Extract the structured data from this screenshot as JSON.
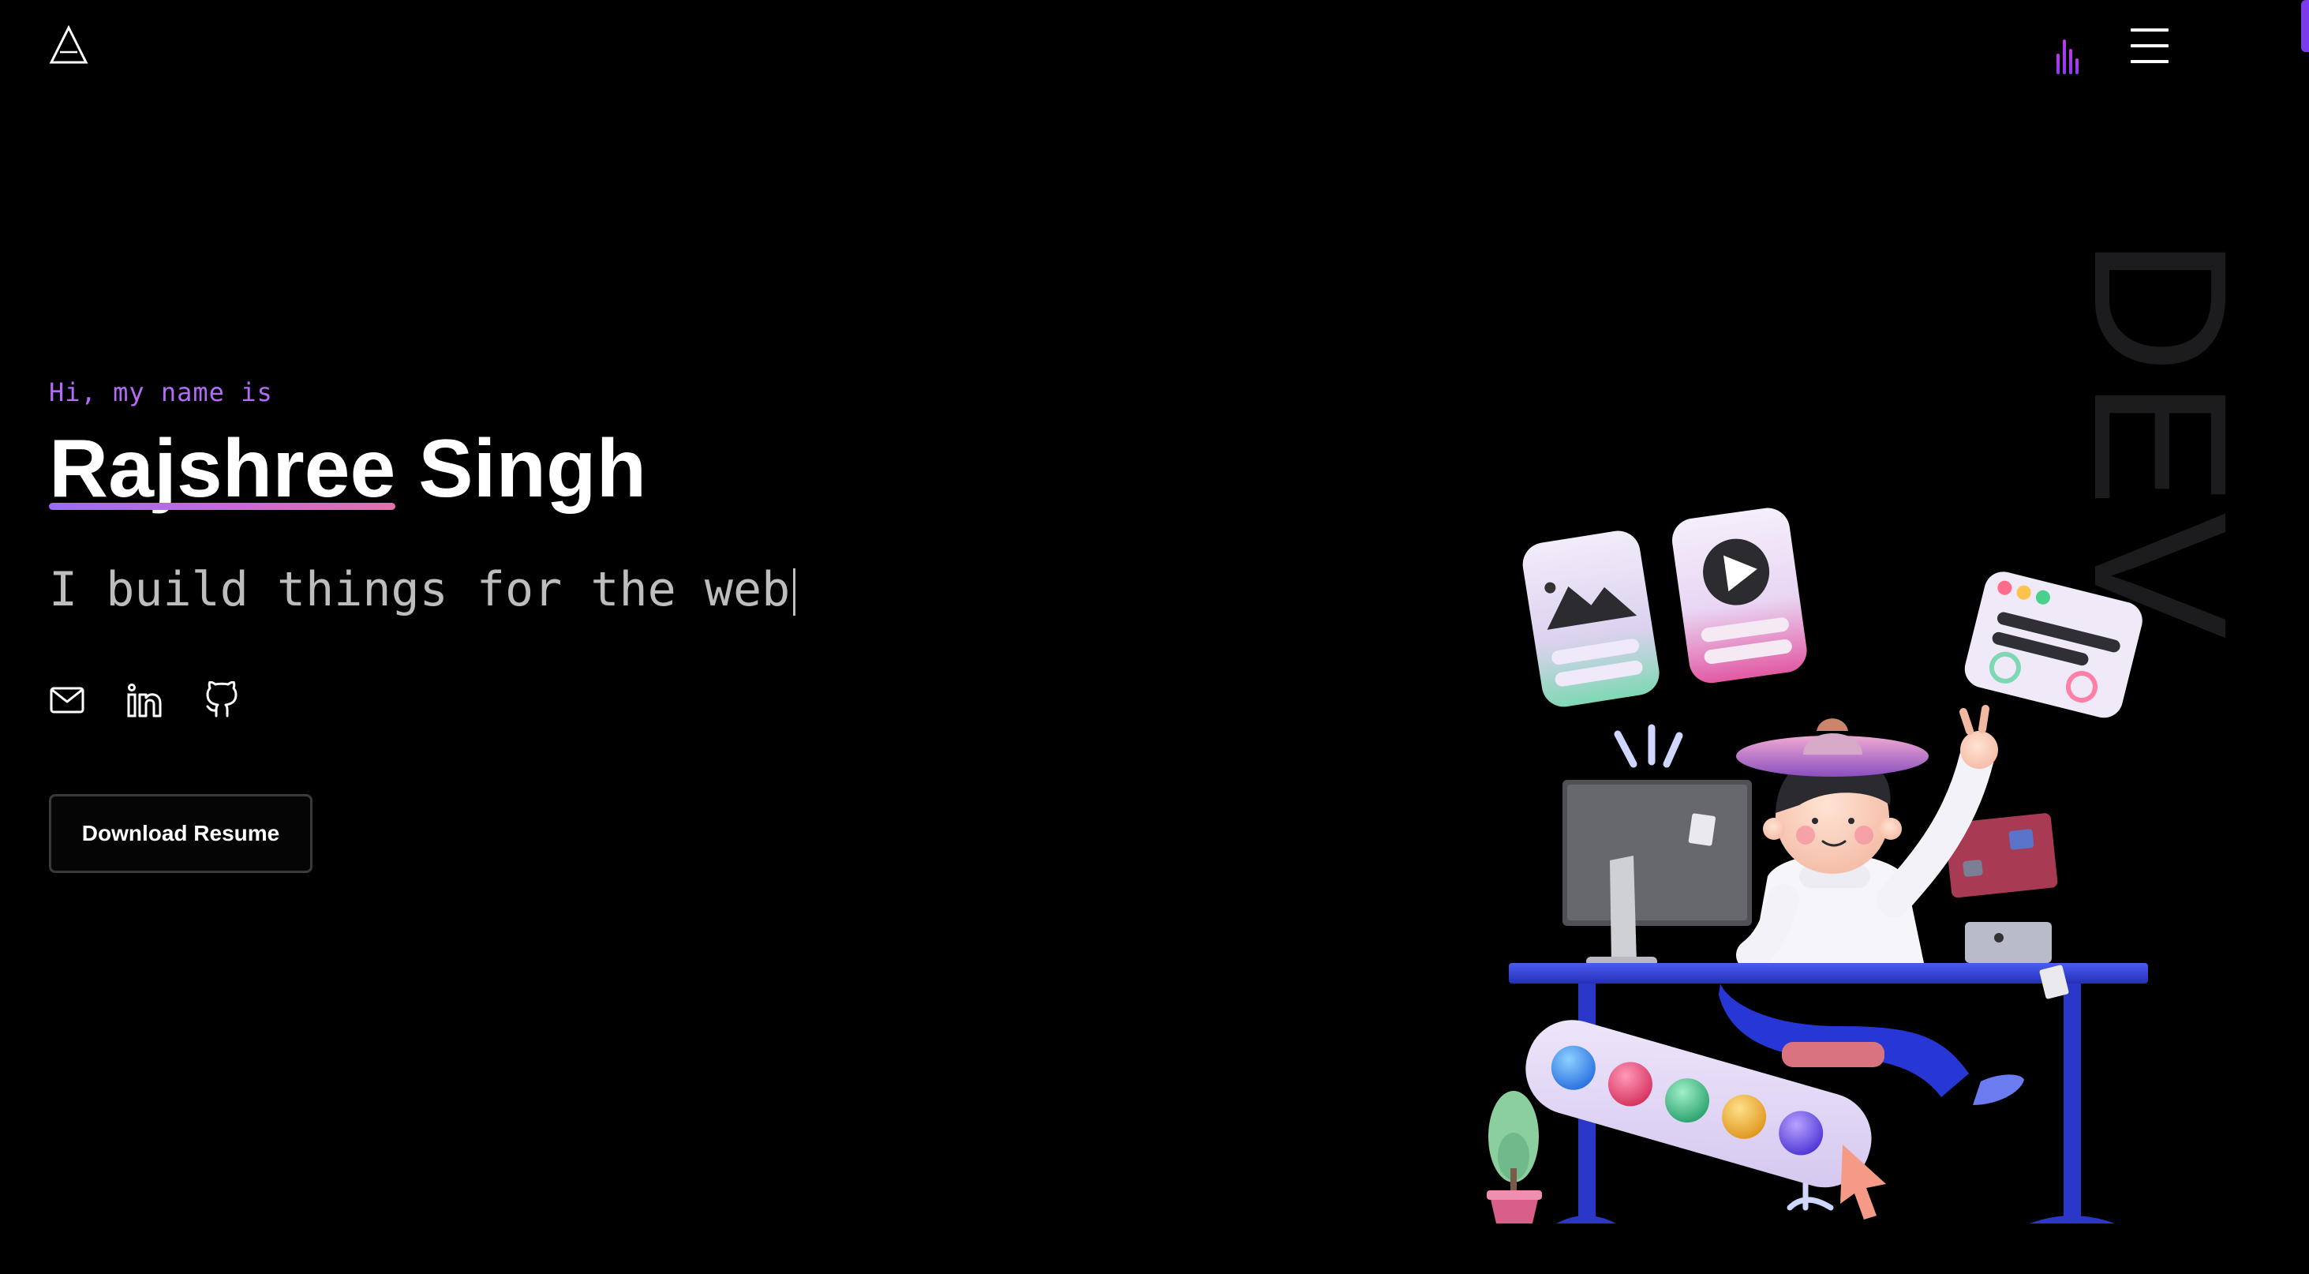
{
  "header": {
    "logo_icon": "triangle-logo-icon",
    "sound_icon": "sound-bars-icon",
    "menu_icon": "hamburger-menu-icon"
  },
  "hero": {
    "greeting": "Hi, my name is",
    "first_name": "Rajshree",
    "last_name": "Singh",
    "tagline": "I build things for the web",
    "side_word": "DEV",
    "resume_button": "Download Resume"
  },
  "socials": [
    {
      "icon": "mail-icon"
    },
    {
      "icon": "linkedin-icon"
    },
    {
      "icon": "github-icon"
    }
  ],
  "colors": {
    "background": "#000000",
    "accent_purple": "#b36cf6",
    "underline_start": "#9b6bff",
    "underline_end": "#e96fae",
    "desk_blue": "#2f3fd6"
  }
}
